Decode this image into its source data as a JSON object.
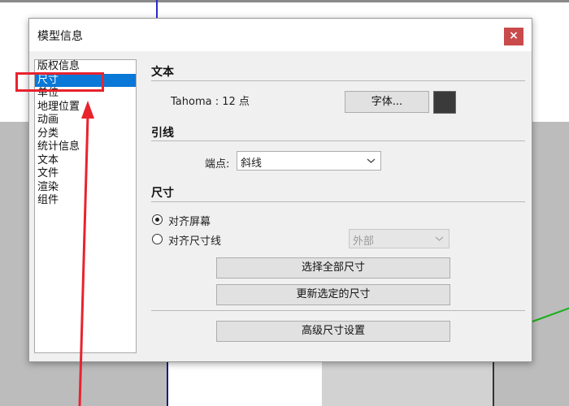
{
  "dialog": {
    "title": "模型信息",
    "close_label": "×"
  },
  "sidebar": {
    "items": [
      {
        "label": "版权信息",
        "selected": false
      },
      {
        "label": "尺寸",
        "selected": true
      },
      {
        "label": "单位",
        "selected": false
      },
      {
        "label": "地理位置",
        "selected": false
      },
      {
        "label": "动画",
        "selected": false
      },
      {
        "label": "分类",
        "selected": false
      },
      {
        "label": "统计信息",
        "selected": false
      },
      {
        "label": "文本",
        "selected": false
      },
      {
        "label": "文件",
        "selected": false
      },
      {
        "label": "渲染",
        "selected": false
      },
      {
        "label": "组件",
        "selected": false
      }
    ]
  },
  "text_section": {
    "title": "文本",
    "font_info": "Tahoma : 12 点",
    "font_button": "字体...",
    "color_swatch": "#3a3a3a"
  },
  "leader_section": {
    "title": "引线",
    "endpoint_label": "端点:",
    "endpoint_value": "斜线"
  },
  "dimension_section": {
    "title": "尺寸",
    "align_screen_label": "对齐屏幕",
    "align_screen_checked": true,
    "align_dimline_label": "对齐尺寸线",
    "align_dimline_checked": false,
    "position_value": "外部",
    "select_all_button": "选择全部尺寸",
    "update_selected_button": "更新选定的尺寸",
    "advanced_button": "高级尺寸设置"
  },
  "icons": {
    "chevron": "chevron-down-icon"
  },
  "colors": {
    "selection": "#0a78d7",
    "close_button": "#c94a4a",
    "annotation": "#e8232e"
  }
}
